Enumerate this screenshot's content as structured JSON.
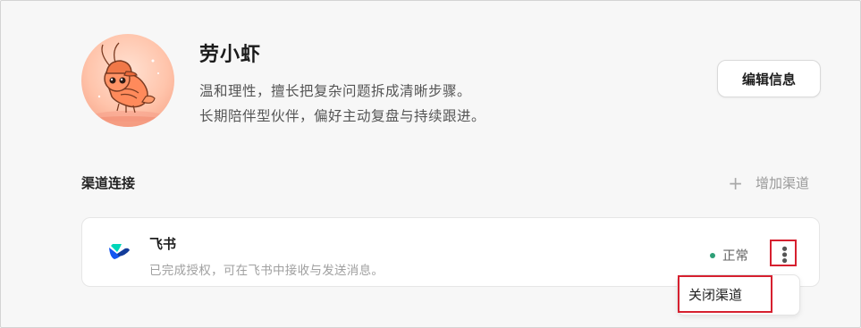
{
  "profile": {
    "name": "劳小虾",
    "bio_line1": "温和理性，擅长把复杂问题拆成清晰步骤。",
    "bio_line2": "长期陪伴型伙伴，偏好主动复盘与持续跟进。",
    "avatar_icon": "shrimp-avatar-icon"
  },
  "actions": {
    "edit_label": "编辑信息"
  },
  "channels": {
    "section_title": "渠道连接",
    "add_label": "增加渠道",
    "add_icon": "plus-icon",
    "items": [
      {
        "name": "飞书",
        "description": "已完成授权，可在飞书中接收与发送消息。",
        "status": "正常",
        "status_color": "#2e9f77",
        "icon": "feishu-logo-icon"
      }
    ]
  },
  "menu": {
    "items": [
      {
        "label": "关闭渠道"
      }
    ]
  },
  "colors": {
    "highlight": "#d6202f",
    "background": "#f7f7f7"
  }
}
